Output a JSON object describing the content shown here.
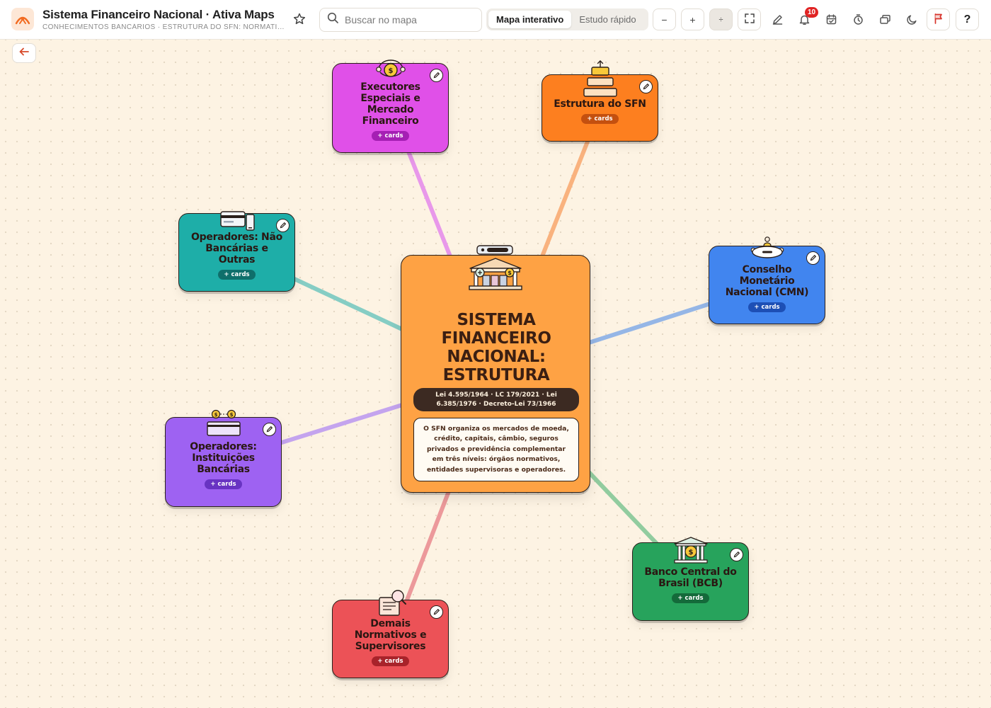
{
  "app": {
    "title": "Sistema Financeiro Nacional · Ativa Maps",
    "subtitle": "CONHECIMENTOS BANCÁRIOS · ESTRUTURA DO SFN: NORMATIVOS",
    "logo_icon": "ativa-maps-logo-icon",
    "favorite_icon": "star-icon"
  },
  "search": {
    "placeholder": "Buscar no mapa",
    "value": "",
    "icon": "search-icon"
  },
  "view_toggle": {
    "options": [
      "Mapa interativo",
      "Estudo rápido"
    ],
    "active": "Mapa interativo"
  },
  "toolbar": {
    "zoom_out_label": "−",
    "zoom_in_label": "+",
    "zoom_reset_label": "÷",
    "notifications_count": "10",
    "help_label": "?",
    "icons": [
      "fullscreen-icon",
      "pencil-icon",
      "bell-icon",
      "calendar-icon",
      "timer-icon",
      "cards-icon",
      "moon-icon",
      "flag-icon"
    ]
  },
  "back_button": {
    "icon": "arrow-left-icon"
  },
  "center": {
    "title": "SISTEMA FINANCEIRO NACIONAL: ESTRUTURA",
    "laws": "Lei 4.595/1964 · LC 179/2021 · Lei 6.385/1976 · Decreto-Lei 73/1966",
    "description": "O SFN organiza os mercados de moeda, crédito, capitais, câmbio, seguros privados e previdência complementar em três níveis: órgãos normativos, entidades supervisoras e operadores.",
    "icon": "bank-building-icon"
  },
  "nodes": [
    {
      "title": "Executores Especiais e Mercado Financeiro",
      "pill": "+ cards",
      "color": "#e050e8",
      "pill_color": "#a51fb4",
      "icon": "coin-cycle-icon"
    },
    {
      "title": "Estrutura do SFN",
      "pill": "+ cards",
      "color": "#fd7f1f",
      "pill_color": "#c4500f",
      "icon": "stacked-layers-icon"
    },
    {
      "title": "Operadores: Não Bancárias e Outras",
      "pill": "+ cards",
      "color": "#1eaea8",
      "pill_color": "#0f6f6b",
      "icon": "card-phone-icon"
    },
    {
      "title": "Conselho Monetário Nacional (CMN)",
      "pill": "+ cards",
      "color": "#4185ef",
      "pill_color": "#1d4fb5",
      "icon": "council-table-icon"
    },
    {
      "title": "Operadores: Instituições Bancárias",
      "pill": "+ cards",
      "color": "#9e62f2",
      "pill_color": "#6833c2",
      "icon": "bank-card-coins-icon"
    },
    {
      "title": "Banco Central do Brasil (BCB)",
      "pill": "+ cards",
      "color": "#27a35c",
      "pill_color": "#146a3a",
      "icon": "central-bank-icon"
    },
    {
      "title": "Demais Normativos e Supervisores",
      "pill": "+ cards",
      "color": "#ec5257",
      "pill_color": "#a8232a",
      "icon": "document-magnifier-icon"
    }
  ],
  "connectors": [
    {
      "to": "Executores Especiais e Mercado Financeiro",
      "color": "#e898ea"
    },
    {
      "to": "Estrutura do SFN",
      "color": "#f9b27e"
    },
    {
      "to": "Operadores: Não Bancárias e Outras",
      "color": "#86cdc4"
    },
    {
      "to": "Conselho Monetário Nacional (CMN)",
      "color": "#95b6e6"
    },
    {
      "to": "Operadores: Instituições Bancárias",
      "color": "#c4a4ee"
    },
    {
      "to": "Banco Central do Brasil (BCB)",
      "color": "#92cc9f"
    },
    {
      "to": "Demais Normativos e Supervisores",
      "color": "#ec999b"
    }
  ]
}
